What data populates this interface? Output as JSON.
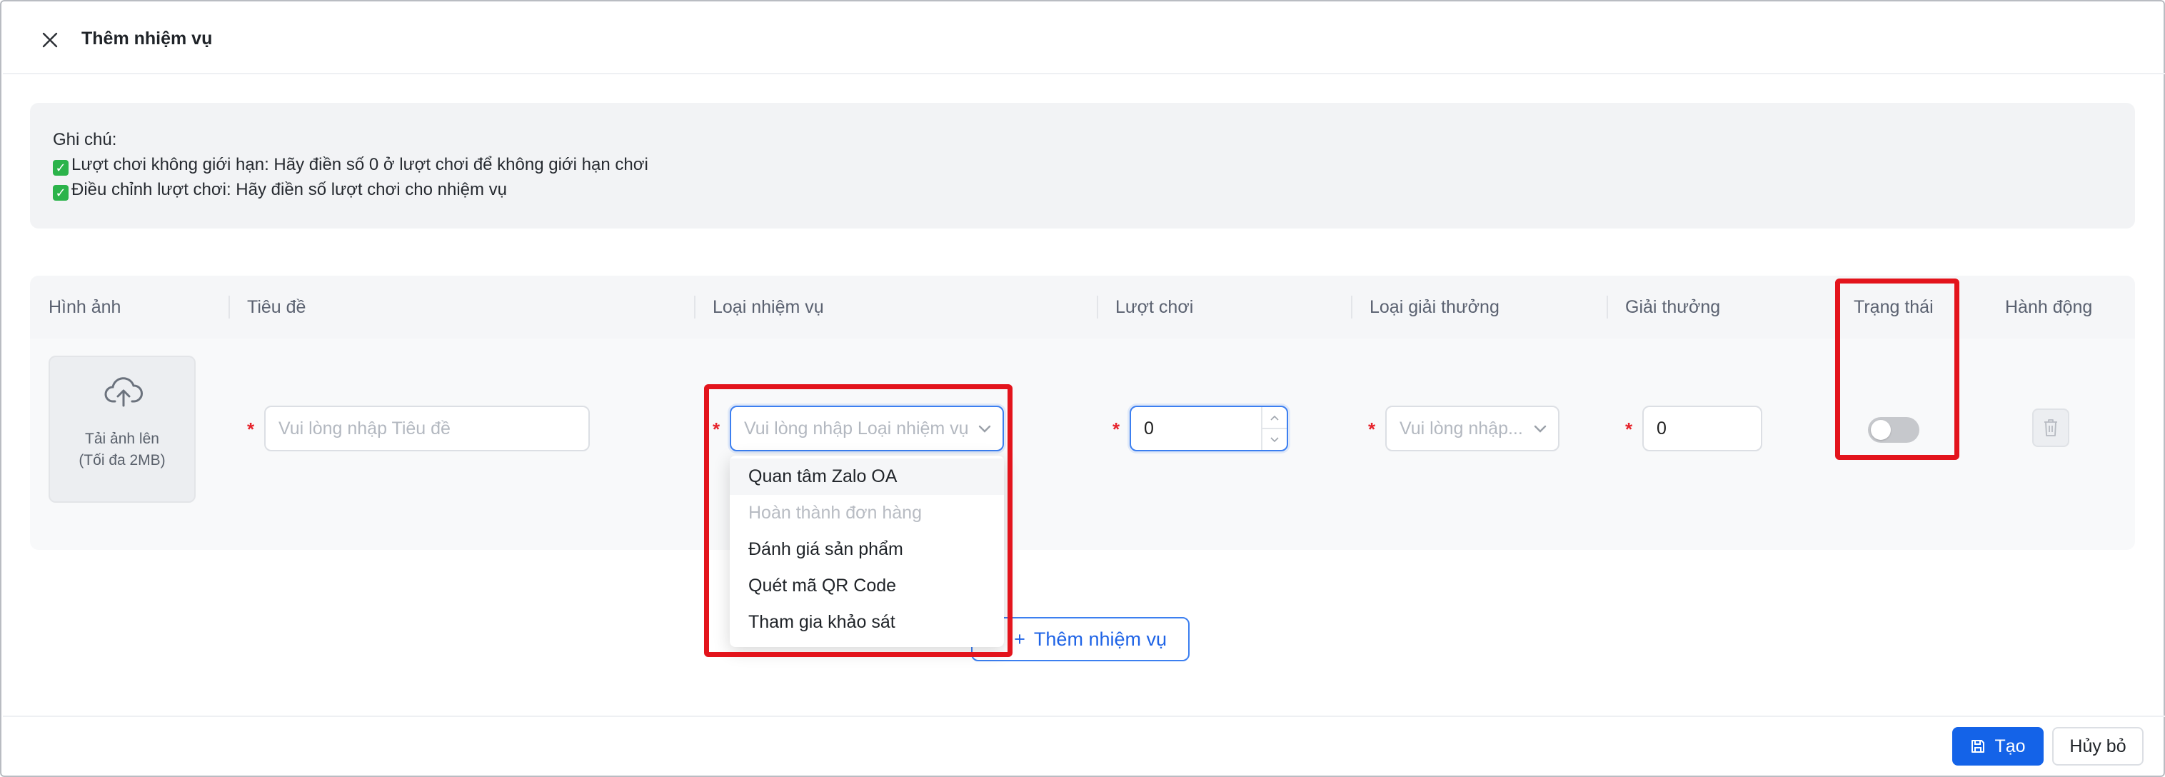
{
  "header": {
    "title": "Thêm nhiệm vụ",
    "close_icon": "close-icon"
  },
  "note": {
    "heading": "Ghi chú:",
    "lines": [
      "Lượt chơi không giới hạn: Hãy điền số 0 ở lượt chơi để không giới hạn chơi",
      "Điều chỉnh lượt chơi: Hãy điền số lượt chơi cho nhiệm vụ"
    ],
    "check_icon": "check-icon",
    "check_color": "#2bb34a"
  },
  "table": {
    "columns": [
      "Hình ảnh",
      "Tiêu đề",
      "Loại nhiệm vụ",
      "Lượt chơi",
      "Loại giải thưởng",
      "Giải thưởng",
      "Trạng thái",
      "Hành động"
    ],
    "row": {
      "upload_line1": "Tải ảnh lên",
      "upload_line2": "(Tối đa 2MB)",
      "upload_icon": "cloud-upload-icon",
      "title_placeholder": "Vui lòng nhập Tiêu đề",
      "type_placeholder": "Vui lòng nhập Loại nhiệm vụ",
      "plays_value": "0",
      "reward_type_placeholder": "Vui lòng nhập...",
      "reward_value": "0",
      "status_on": false,
      "delete_icon": "trash-icon"
    }
  },
  "dropdown": {
    "options": [
      {
        "label": "Quan tâm Zalo OA",
        "state": "active"
      },
      {
        "label": "Hoàn thành đơn hàng",
        "state": "disabled"
      },
      {
        "label": "Đánh giá sản phẩm",
        "state": "normal"
      },
      {
        "label": "Quét mã QR Code",
        "state": "normal"
      },
      {
        "label": "Tham gia khảo sát",
        "state": "normal"
      }
    ]
  },
  "add_button": {
    "label": "Thêm nhiệm vụ",
    "icon": "plus-icon"
  },
  "footer": {
    "create_label": "Tạo",
    "create_icon": "save-icon",
    "cancel_label": "Hủy bỏ"
  },
  "colors": {
    "primary": "#1463e8",
    "highlight": "#e3141c",
    "required": "#e6242c"
  }
}
